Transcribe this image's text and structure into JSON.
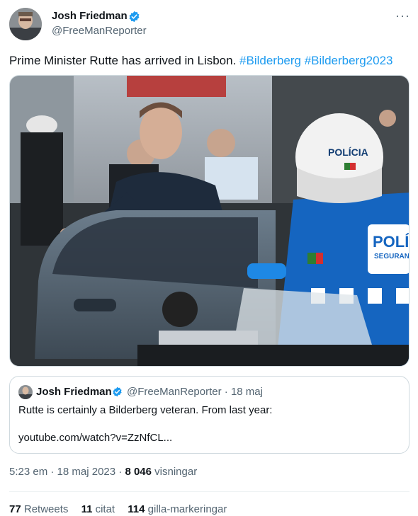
{
  "tweet": {
    "author_name": "Josh Friedman",
    "author_handle": "@FreeManReporter",
    "more_label": "···",
    "text_plain": "Prime Minister Rutte has arrived in Lisbon.",
    "hashtag1": "#Bilderberg",
    "hashtag2": "#Bilderberg2023"
  },
  "media": {
    "police_label_helmet": "POLÍCIA",
    "police_label_jacket": "POLÍ",
    "police_label_jacket2": "SEGURAN"
  },
  "quote": {
    "author_name": "Josh Friedman",
    "author_handle": "@FreeManReporter",
    "dot": "·",
    "date": "18 maj",
    "text": "Rutte is certainly a Bilderberg veteran. From last year:",
    "link": "youtube.com/watch?v=ZzNfCL..."
  },
  "meta": {
    "time": "5:23 em",
    "dot1": "·",
    "date": "18 maj 2023",
    "dot2": "·",
    "views_count": "8 046",
    "views_label": "visningar"
  },
  "stats": {
    "retweets_count": "77",
    "retweets_label": "Retweets",
    "quotes_count": "11",
    "quotes_label": "citat",
    "likes_count": "114",
    "likes_label": "gilla-markeringar"
  },
  "colors": {
    "accent": "#1d9bf0",
    "secondary_text": "#536471",
    "border": "#cfd9de"
  }
}
